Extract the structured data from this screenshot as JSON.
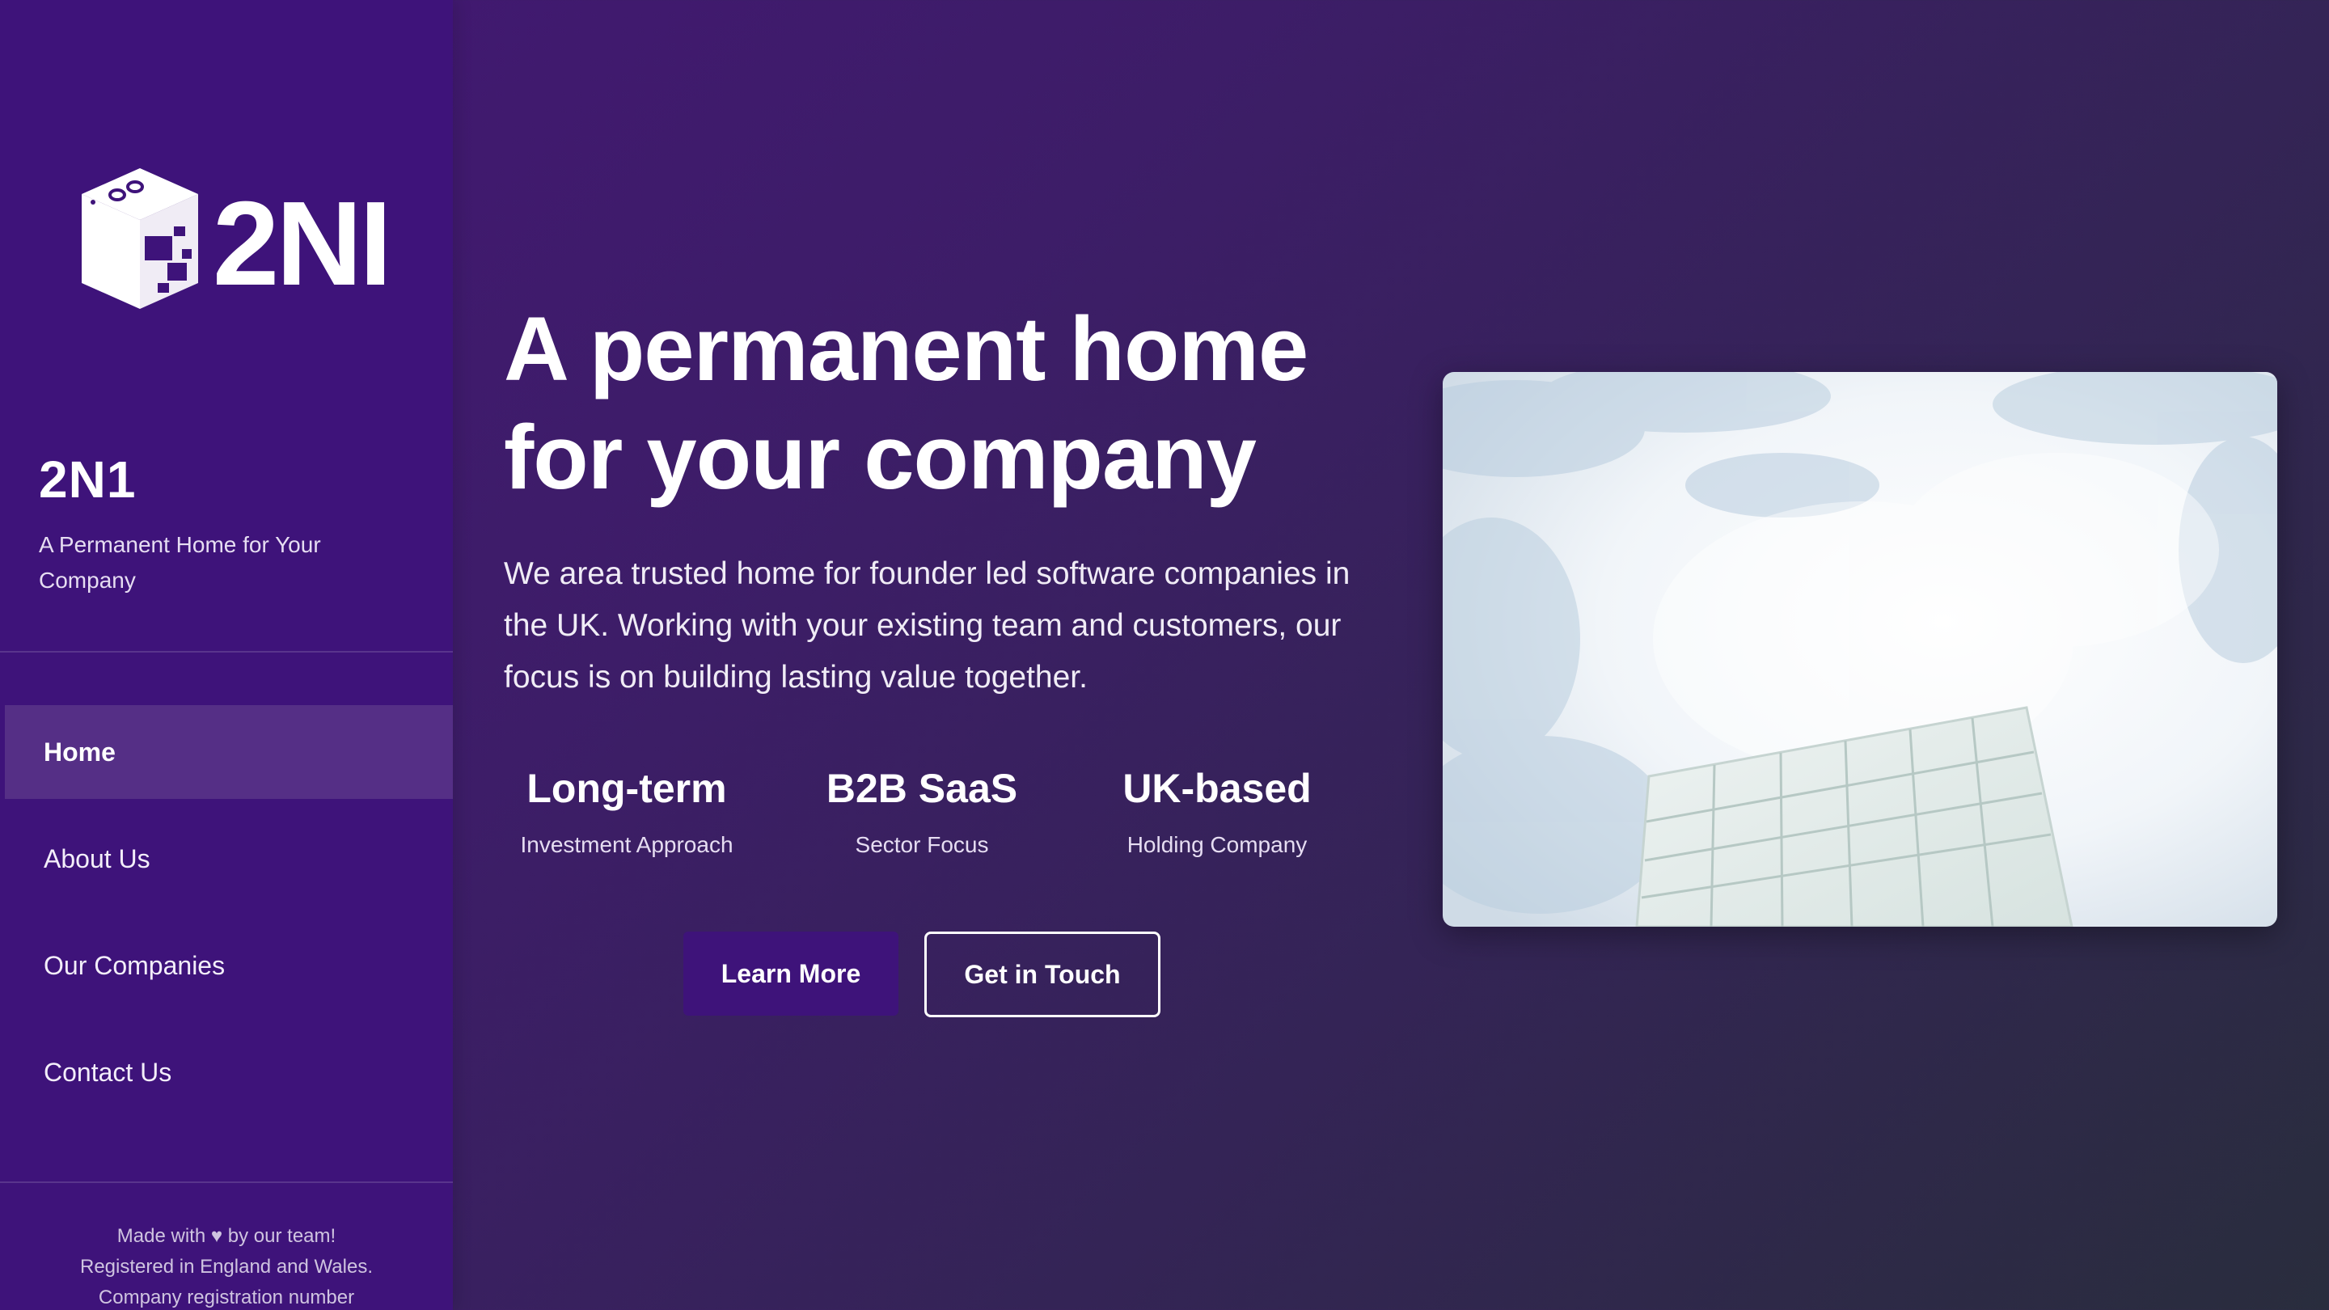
{
  "sidebar": {
    "logo": {
      "text": "2NI",
      "icon": "cube-logo-icon"
    },
    "brand_name": "2N1",
    "tagline": "A Permanent Home for Your Company",
    "nav": [
      {
        "label": "Home",
        "active": true
      },
      {
        "label": "About Us",
        "active": false
      },
      {
        "label": "Our Companies",
        "active": false
      },
      {
        "label": "Contact Us",
        "active": false
      }
    ],
    "footer": {
      "made_with_prefix": "Made with",
      "heart_icon": "heart-icon",
      "made_with_suffix": "by our team!",
      "registered": "Registered in England and Wales.",
      "company_reg": "Company registration number"
    }
  },
  "hero": {
    "title_line1": "A permanent home",
    "title_line2": "for your company",
    "description": "We area trusted home for founder led software companies in the UK. Working with your existing team and customers, our focus is on building lasting value together.",
    "stats": [
      {
        "value": "Long-term",
        "label": "Investment Approach"
      },
      {
        "value": "B2B SaaS",
        "label": "Sector Focus"
      },
      {
        "value": "UK-based",
        "label": "Holding Company"
      }
    ],
    "buttons": {
      "primary": "Learn More",
      "secondary": "Get in Touch"
    },
    "image": "sky-and-glass-building-photo"
  },
  "colors": {
    "sidebar_bg": "#3e137a",
    "nav_active_bg": "#552f86",
    "button_primary_bg": "#3e137a",
    "page_gradient_start": "#431774",
    "page_gradient_end": "#292d3d"
  }
}
